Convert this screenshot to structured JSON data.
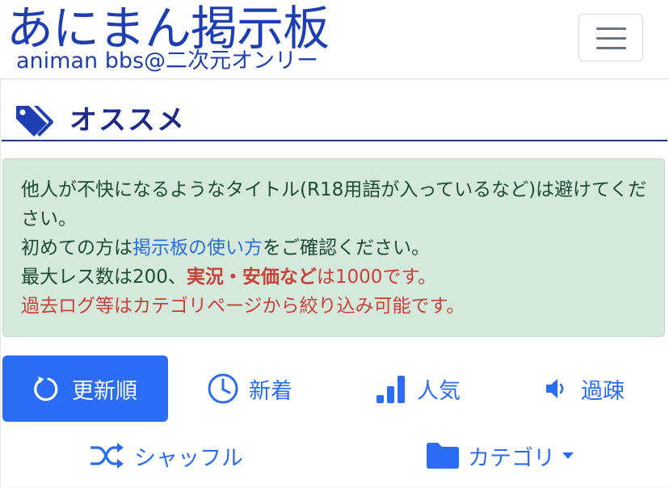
{
  "header": {
    "logo_title": "あにまん掲示板",
    "logo_subtitle": "animan bbs@二次元オンリー",
    "menu_button": "hamburger-menu"
  },
  "section": {
    "title": "オススメ",
    "icon": "tags-icon"
  },
  "notice": {
    "line1": "他人が不快になるようなタイトル(R18用語が入っているなど)は避けてください。",
    "line2_prefix": "初めての方は",
    "line2_link": "掲示板の使い方",
    "line2_suffix": "をご確認ください。",
    "line3_prefix": "最大レス数は200、",
    "line3_bold": "実況・安価など",
    "line3_suffix": "は1000です。",
    "line4": "過去ログ等はカテゴリページから絞り込み可能です。"
  },
  "sort_buttons": [
    {
      "label": "更新順",
      "icon": "refresh-icon",
      "active": true
    },
    {
      "label": "新着",
      "icon": "clock-icon",
      "active": false
    },
    {
      "label": "人気",
      "icon": "signal-bars-icon",
      "active": false
    },
    {
      "label": "過疎",
      "icon": "speaker-low-icon",
      "active": false
    },
    {
      "label": "シャッフル",
      "icon": "shuffle-icon",
      "active": false
    },
    {
      "label": "カテゴリ",
      "icon": "folder-icon",
      "active": false,
      "dropdown": true
    }
  ],
  "colors": {
    "brand": "#1e3fb4",
    "accent": "#2b6cf4",
    "notice_bg": "#d4e8dc",
    "warning": "#c8423a"
  }
}
